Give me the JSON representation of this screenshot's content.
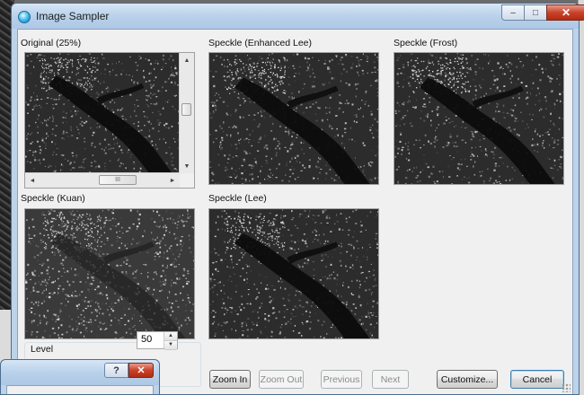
{
  "window": {
    "title": "Image Sampler",
    "icon": "image-sampler-icon",
    "controls": {
      "minimize": "–",
      "maximize": "□",
      "close": "✕"
    }
  },
  "panels": [
    {
      "key": "original",
      "label": "Original (25%)"
    },
    {
      "key": "enhanced_lee",
      "label": "Speckle (Enhanced Lee)"
    },
    {
      "key": "frost",
      "label": "Speckle (Frost)"
    },
    {
      "key": "kuan",
      "label": "Speckle (Kuan)"
    },
    {
      "key": "lee",
      "label": "Speckle (Lee)"
    }
  ],
  "original_scroll": {
    "hscroll_thumb_glyph": "III",
    "arrows": {
      "up": "▲",
      "down": "▼",
      "left": "◄",
      "right": "►"
    }
  },
  "level": {
    "label": "Level",
    "value": "50",
    "spin_up": "▲",
    "spin_down": "▼"
  },
  "buttons": {
    "zoom_in": "Zoom In",
    "zoom_out": "Zoom Out",
    "previous": "Previous",
    "next": "Next",
    "customize": "Customize...",
    "cancel": "Cancel"
  },
  "dialog": {
    "help": "?",
    "close": "✕"
  },
  "colors": {
    "title_bar": "#b9d1ea",
    "client_bg": "#f0f0f0",
    "close_red": "#c7432a"
  }
}
